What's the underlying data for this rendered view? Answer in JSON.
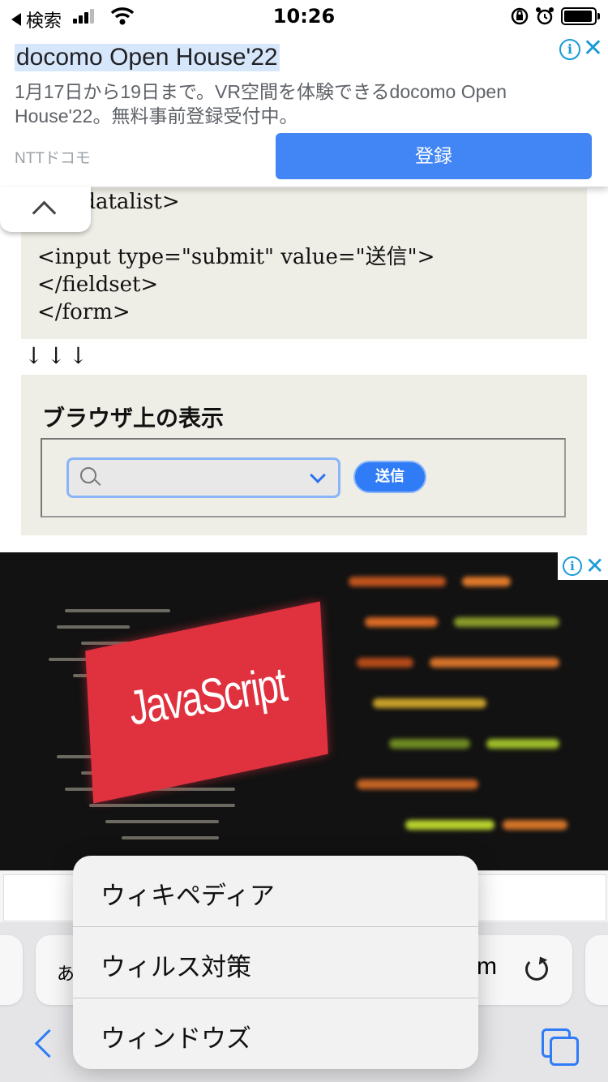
{
  "status_bar": {
    "back_label": "検索",
    "time": "10:26"
  },
  "top_ad": {
    "title": "docomo Open House'22",
    "description": "1月17日から19日まで。VR空間を体験できるdocomo Open House'22。無料事前登録受付中。",
    "advertiser": "NTTドコモ",
    "cta_label": "登録",
    "info_glyph": "i",
    "close_glyph": "✕"
  },
  "article": {
    "code_lines": "   </datalist>\n\n<input type=\"submit\" value=\"送信\">\n</fieldset>\n</form>",
    "arrows": "↓↓↓",
    "demo_heading": "ブラウザ上の表示",
    "submit_label": "送信"
  },
  "image_ad": {
    "headline": "JavaScript",
    "info_glyph": "i",
    "close_glyph": "✕"
  },
  "address_bar": {
    "left_text": "あ",
    "url_tail": "m"
  },
  "suggestions": [
    {
      "label": "ウィキペディア"
    },
    {
      "label": "ウィルス対策"
    },
    {
      "label": "ウィンドウズ"
    }
  ],
  "icons": [
    "signal-icon",
    "wifi-icon",
    "lock-rotation-icon",
    "alarm-icon",
    "battery-icon",
    "search-icon",
    "chevron-down-icon",
    "chevron-up-icon",
    "reload-icon",
    "back-icon",
    "tabs-icon",
    "info-icon",
    "close-icon"
  ],
  "colors": {
    "accent": "#2f7cf6",
    "ad_cta": "#4285f4",
    "code_bg": "#efeee6",
    "js_banner": "#e0313f"
  }
}
